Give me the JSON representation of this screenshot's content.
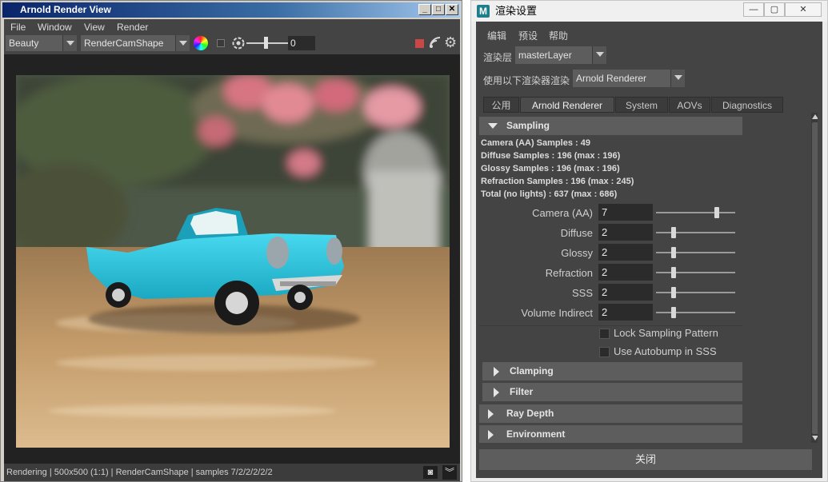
{
  "render_view": {
    "title": "Arnold Render View",
    "menu": [
      "File",
      "Window",
      "View",
      "Render"
    ],
    "aov_combo": "Beauty",
    "camera_combo": "RenderCamShape",
    "exposure_value": "0",
    "status": "Rendering | 500x500 (1:1) | RenderCamShape  | samples 7/2/2/2/2/2"
  },
  "render_settings": {
    "title": "渲染设置",
    "logo": "M",
    "menu": [
      "编辑",
      "预设",
      "帮助"
    ],
    "render_layer_label": "渲染层",
    "render_layer_value": "masterLayer",
    "renderer_label": "使用以下渲染器渲染",
    "renderer_value": "Arnold Renderer",
    "tabs": [
      "公用",
      "Arnold Renderer",
      "System",
      "AOVs",
      "Diagnostics"
    ],
    "sampling": {
      "header": "Sampling",
      "info": [
        "Camera (AA) Samples : 49",
        "Diffuse Samples : 196 (max : 196)",
        "Glossy Samples : 196 (max : 196)",
        "Refraction Samples : 196 (max : 245)",
        "Total (no lights) : 637 (max : 686)"
      ],
      "params": [
        {
          "label": "Camera (AA)",
          "value": "7",
          "level": 0.77
        },
        {
          "label": "Diffuse",
          "value": "2",
          "level": 0.22
        },
        {
          "label": "Glossy",
          "value": "2",
          "level": 0.22
        },
        {
          "label": "Refraction",
          "value": "2",
          "level": 0.22
        },
        {
          "label": "SSS",
          "value": "2",
          "level": 0.22
        },
        {
          "label": "Volume Indirect",
          "value": "2",
          "level": 0.22
        }
      ],
      "checkboxes": [
        "Lock Sampling Pattern",
        "Use Autobump in SSS"
      ]
    },
    "collapsed_sections": [
      "Clamping",
      "Filter",
      "Ray Depth",
      "Environment"
    ],
    "close_label": "关闭"
  }
}
